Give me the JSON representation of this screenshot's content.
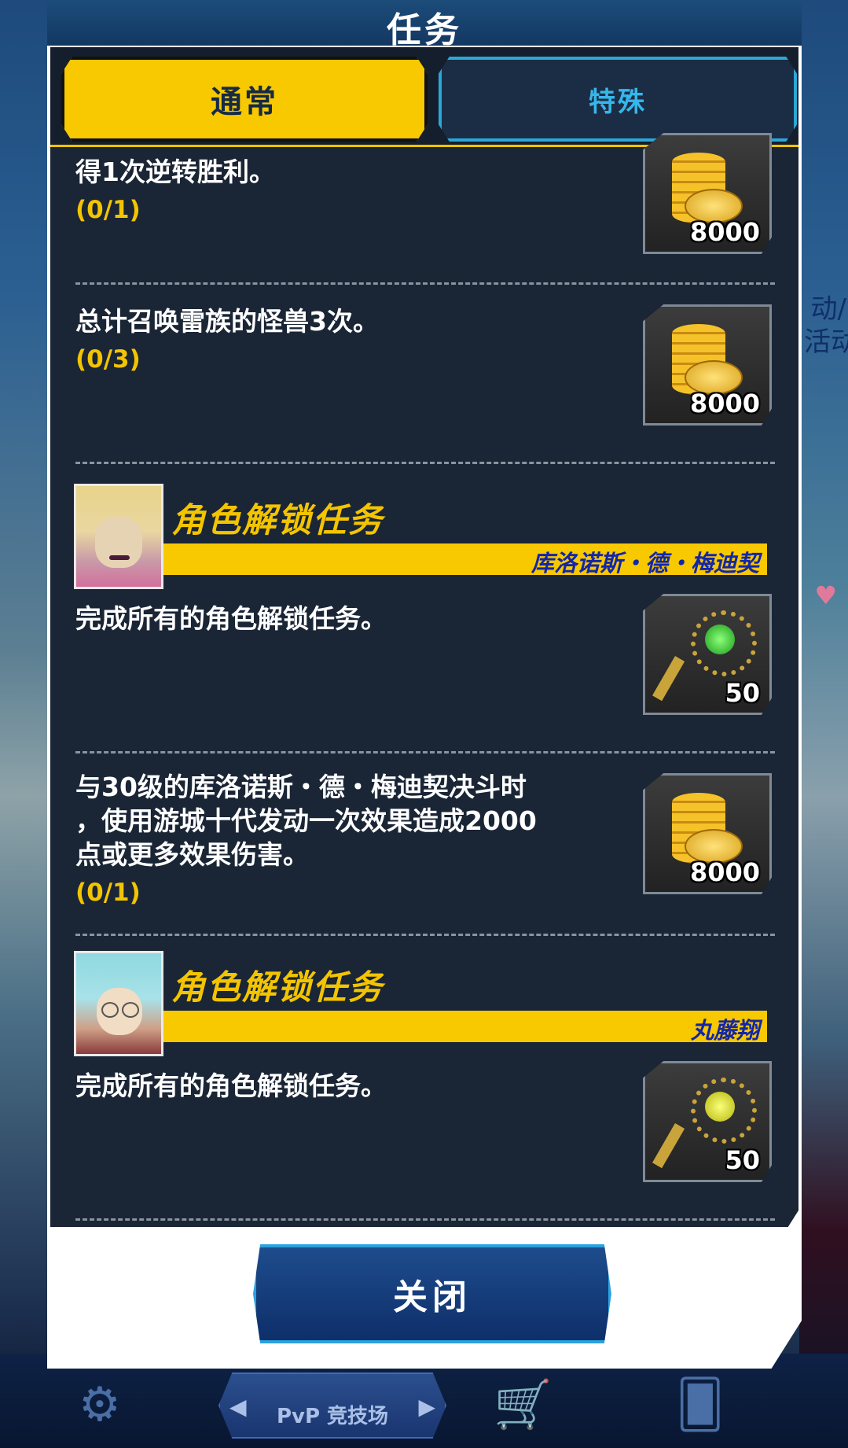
{
  "background": {
    "right_label": "动/\n活动",
    "pvp_label": "PvP 竞技场"
  },
  "dialog": {
    "title": "任务",
    "tabs": [
      {
        "label": "通常",
        "active": true
      },
      {
        "label": "特殊",
        "active": false
      }
    ],
    "missions": [
      {
        "text": "得1次逆转胜利。",
        "progress": "(0/1)",
        "reward_icon": "gold-coins-icon",
        "reward_qty": "8000"
      },
      {
        "text": "总计召唤雷族的怪兽3次。",
        "progress": "(0/3)",
        "reward_icon": "gold-coins-icon",
        "reward_qty": "8000"
      },
      {
        "section_title": "角色解锁任务",
        "character": "库洛诺斯・德・梅迪契",
        "text": "完成所有的角色解锁任务。",
        "reward_icon": "green-key-icon",
        "reward_qty": "50"
      },
      {
        "text_lines": [
          "与30级的库洛诺斯・德・梅迪契决斗时",
          "，使用游城十代发动一次效果造成2000",
          "点或更多效果伤害。"
        ],
        "progress": "(0/1)",
        "reward_icon": "gold-coins-icon",
        "reward_qty": "8000"
      },
      {
        "section_title": "角色解锁任务",
        "character": "丸藤翔",
        "text": "完成所有的角色解锁任务。",
        "reward_icon": "yellow-key-icon",
        "reward_qty": "50"
      }
    ],
    "close_label": "关闭"
  },
  "colors": {
    "accent_yellow": "#f8c800",
    "panel_bg": "#1a2535",
    "tab_active_text": "#142a45",
    "tab_inactive_text": "#37b6ea",
    "character_name": "#1326a8",
    "close_button": "#0e2f6a"
  }
}
